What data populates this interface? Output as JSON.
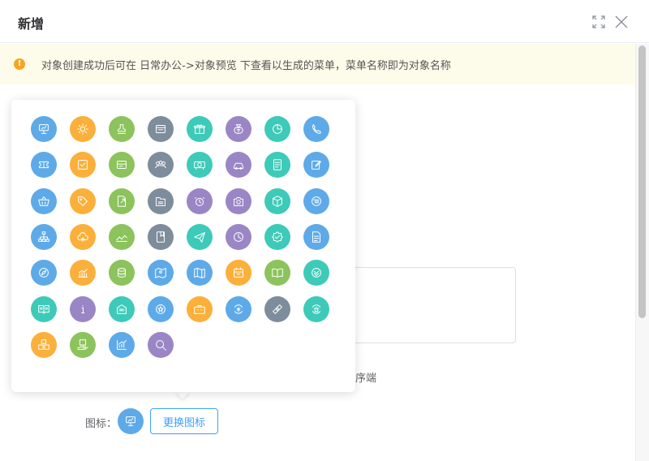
{
  "dialog": {
    "title": "新增",
    "fullscreen_icon": "fullscreen-icon",
    "close_icon": "close-icon"
  },
  "notice": {
    "icon": "warning-icon",
    "text": "对象创建成功后可在 日常办公->对象预览 下查看以生成的菜单，菜单名称即为对象名称"
  },
  "background": {
    "partial_label": "序端"
  },
  "colors": {
    "blue": "#5eaae8",
    "orange": "#fbb03b",
    "green": "#8cc35c",
    "slate": "#7e8d9b",
    "teal": "#3ecab8",
    "purple": "#9b86c5",
    "accent": "#409eff"
  },
  "icon_picker": {
    "icons": [
      {
        "name": "presentation-icon",
        "color": "blue"
      },
      {
        "name": "gear-icon",
        "color": "orange"
      },
      {
        "name": "stamp-icon",
        "color": "green"
      },
      {
        "name": "calendar-card-icon",
        "color": "slate"
      },
      {
        "name": "gift-icon",
        "color": "teal"
      },
      {
        "name": "money-bag-icon",
        "color": "purple"
      },
      {
        "name": "pie-chart-icon",
        "color": "teal"
      },
      {
        "name": "phone-icon",
        "color": "blue"
      },
      {
        "name": "ticket-icon",
        "color": "blue"
      },
      {
        "name": "checkbox-icon",
        "color": "orange"
      },
      {
        "name": "card-icon",
        "color": "green"
      },
      {
        "name": "group-icon",
        "color": "slate"
      },
      {
        "name": "projector-icon",
        "color": "teal"
      },
      {
        "name": "car-icon",
        "color": "purple"
      },
      {
        "name": "document-icon",
        "color": "teal"
      },
      {
        "name": "edit-icon",
        "color": "blue"
      },
      {
        "name": "basket-icon",
        "color": "blue"
      },
      {
        "name": "tag-icon",
        "color": "orange"
      },
      {
        "name": "file-export-icon",
        "color": "green"
      },
      {
        "name": "folder-icon",
        "color": "slate"
      },
      {
        "name": "alarm-clock-icon",
        "color": "purple"
      },
      {
        "name": "camera-icon",
        "color": "purple"
      },
      {
        "name": "box-icon",
        "color": "teal"
      },
      {
        "name": "list-icon",
        "color": "blue"
      },
      {
        "name": "org-chart-icon",
        "color": "blue"
      },
      {
        "name": "cloud-upload-icon",
        "color": "orange"
      },
      {
        "name": "trend-icon",
        "color": "green"
      },
      {
        "name": "bookmark-icon",
        "color": "slate"
      },
      {
        "name": "paper-plane-icon",
        "color": "teal"
      },
      {
        "name": "clock-icon",
        "color": "purple"
      },
      {
        "name": "badge-check-icon",
        "color": "teal"
      },
      {
        "name": "report-icon",
        "color": "blue"
      },
      {
        "name": "compass-icon",
        "color": "blue"
      },
      {
        "name": "bar-chart-icon",
        "color": "orange"
      },
      {
        "name": "database-icon",
        "color": "green"
      },
      {
        "name": "location-map-icon",
        "color": "blue"
      },
      {
        "name": "map-icon",
        "color": "blue"
      },
      {
        "name": "calendar-icon",
        "color": "orange"
      },
      {
        "name": "open-book-icon",
        "color": "green"
      },
      {
        "name": "chevron-down-circle-icon",
        "color": "teal"
      },
      {
        "name": "book-icon",
        "color": "teal"
      },
      {
        "name": "info-icon",
        "color": "purple"
      },
      {
        "name": "inbox-icon",
        "color": "teal"
      },
      {
        "name": "star-icon",
        "color": "blue"
      },
      {
        "name": "suitcase-icon",
        "color": "orange"
      },
      {
        "name": "customer-cycle-icon",
        "color": "blue"
      },
      {
        "name": "money-icon",
        "color": "slate"
      },
      {
        "name": "merchant-cycle-icon",
        "color": "teal"
      },
      {
        "name": "boxes-icon",
        "color": "orange"
      },
      {
        "name": "hand-box-icon",
        "color": "green"
      },
      {
        "name": "growth-chart-icon",
        "color": "blue"
      },
      {
        "name": "search-icon",
        "color": "purple"
      }
    ]
  },
  "form": {
    "icon_label": "图标：",
    "selected_icon": "presentation-icon",
    "selected_icon_color": "blue",
    "change_button": "更换图标"
  }
}
